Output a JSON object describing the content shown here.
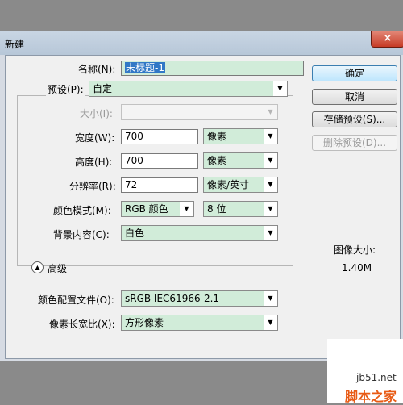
{
  "window": {
    "title": "新建",
    "close_glyph": "×"
  },
  "name": {
    "label": "名称(N):",
    "value": "未标题-1"
  },
  "preset": {
    "label": "预设(P):",
    "value": "自定"
  },
  "size": {
    "label": "大小(I):",
    "value": ""
  },
  "width": {
    "label": "宽度(W):",
    "value": "700",
    "unit": "像素"
  },
  "height": {
    "label": "高度(H):",
    "value": "700",
    "unit": "像素"
  },
  "resolution": {
    "label": "分辨率(R):",
    "value": "72",
    "unit": "像素/英寸"
  },
  "color_mode": {
    "label": "颜色模式(M):",
    "value": "RGB 颜色",
    "depth": "8 位"
  },
  "background": {
    "label": "背景内容(C):",
    "value": "白色"
  },
  "advanced": {
    "label": "高级",
    "icon": "collapse-icon"
  },
  "color_profile": {
    "label": "颜色配置文件(O):",
    "value": "sRGB IEC61966-2.1"
  },
  "pixel_aspect": {
    "label": "像素长宽比(X):",
    "value": "方形像素"
  },
  "buttons": {
    "ok": "确定",
    "cancel": "取消",
    "save_preset": "存储预设(S)...",
    "delete_preset": "删除预设(D)..."
  },
  "image_size": {
    "label": "图像大小:",
    "value": "1.40M"
  },
  "watermark": {
    "site": "jb51.net",
    "brand": "脚本之家"
  },
  "colors": {
    "select_bg": "#d1ecd9",
    "primary_button": "#bee6fd"
  }
}
